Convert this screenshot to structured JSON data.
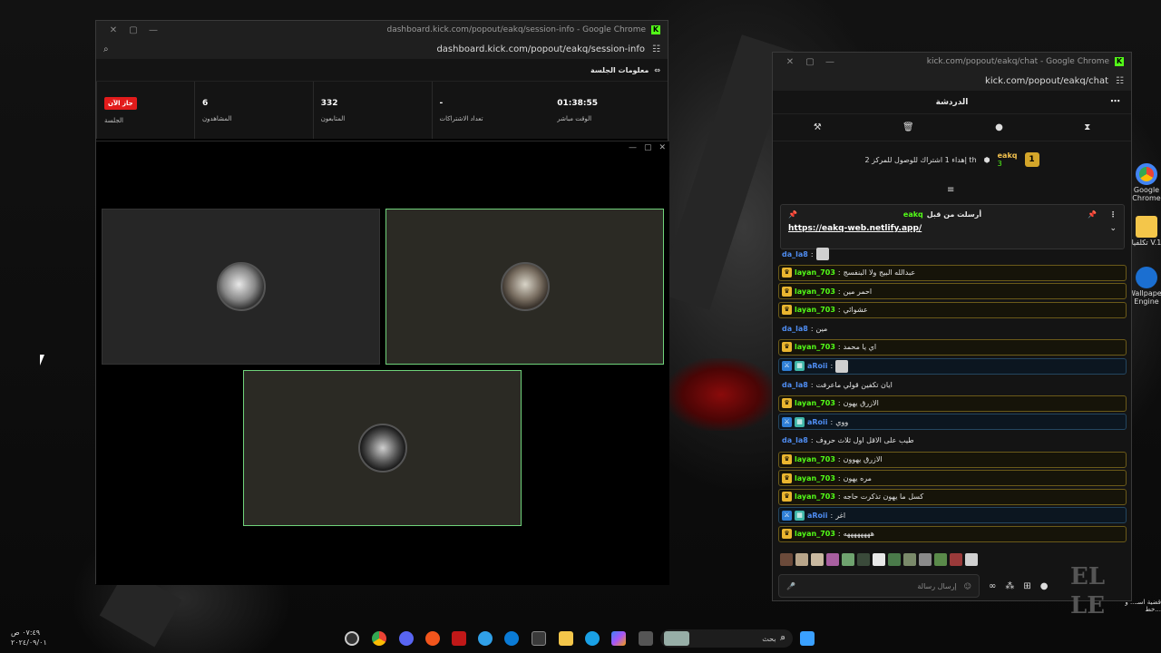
{
  "session_window": {
    "title": "dashboard.kick.com/popout/eakq/session-info - Google Chrome",
    "url": "dashboard.kick.com/popout/eakq/session-info",
    "header": "معلومات الجلسة",
    "stats": [
      {
        "value": "01:38:55",
        "label": "الوقت مباشر"
      },
      {
        "value": "-",
        "label": "تعداد الاشتراكات"
      },
      {
        "value": "332",
        "label": "المتابعون"
      },
      {
        "value": "6",
        "label": "المشاهدون"
      },
      {
        "value": "",
        "label": "الجلسة",
        "badge": "جاز الآن"
      }
    ]
  },
  "chat_window": {
    "title": "kick.com/popout/eakq/chat - Google Chrome",
    "url": "kick.com/popout/eakq/chat",
    "header": "الدردشة",
    "goal": {
      "rank": "1",
      "user": "eakq",
      "count": "3",
      "text": "إهداء 1 اشتراك للوصول للمركز 2 th"
    },
    "pinned": {
      "by_label": "أرسلت من قبل",
      "user": "eakq",
      "link": "https://eakq-web.netlify.app/"
    },
    "messages": [
      {
        "user": "da_la8",
        "text": "",
        "style": "plain",
        "thumb": true
      },
      {
        "user": "layan_703",
        "text": "عبدالله البيج ولا البنفسج",
        "style": "vip"
      },
      {
        "user": "layan_703",
        "text": "احمر مين",
        "style": "vip"
      },
      {
        "user": "layan_703",
        "text": "عشوائي",
        "style": "vip"
      },
      {
        "user": "da_la8",
        "text": "مين",
        "style": "plain"
      },
      {
        "user": "layan_703",
        "text": "اي يا محمد",
        "style": "vip"
      },
      {
        "user": "aRoii",
        "text": "",
        "style": "mod",
        "thumb": true
      },
      {
        "user": "da_la8",
        "text": "ايان تكفين قولي ماعرفت",
        "style": "plain"
      },
      {
        "user": "layan_703",
        "text": "الازرق يهون",
        "style": "vip"
      },
      {
        "user": "aRoii",
        "text": "ووي",
        "style": "mod"
      },
      {
        "user": "da_la8",
        "text": "طيب على الاقل اول ثلاث حروف",
        "style": "plain"
      },
      {
        "user": "layan_703",
        "text": "الازرق يهوون",
        "style": "vip"
      },
      {
        "user": "layan_703",
        "text": "مره يهون",
        "style": "vip"
      },
      {
        "user": "layan_703",
        "text": "كسل ما يهون تذكرت حاجه",
        "style": "vip"
      },
      {
        "user": "aRoii",
        "text": "اغر",
        "style": "mod"
      },
      {
        "user": "layan_703",
        "text": "ههههههههه",
        "style": "vip"
      }
    ],
    "input_placeholder": "إرسال رسالة"
  },
  "desktop": {
    "icons": [
      {
        "label": "Google Chrome"
      },
      {
        "label": "تكلفيا V.1"
      },
      {
        "label": "Wallpaper Engine"
      }
    ],
    "search_label": "بحث",
    "clock_time": "٠٧:٤٩ ص",
    "clock_date": "٢٠٢٤/٠٩/٠١",
    "notif_text": "قضية اسـ... و خط..."
  },
  "colors": {
    "kick_green": "#53fc18",
    "live_red": "#e21b1b",
    "vip_gold": "#e9b52f",
    "mod_blue": "#2f7fd6"
  }
}
